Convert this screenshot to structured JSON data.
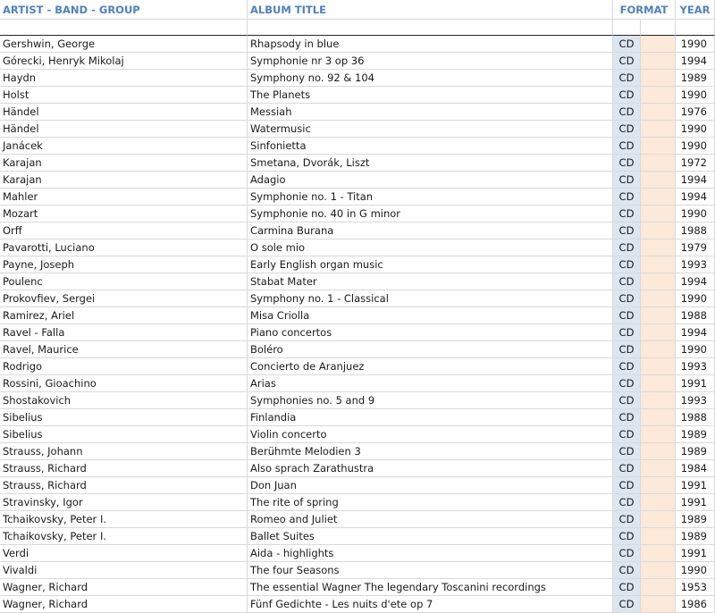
{
  "headers": {
    "artist": "ARTIST - BAND - GROUP",
    "album": "ALBUM TITLE",
    "format": "FORMAT",
    "year": "YEAR"
  },
  "colors": {
    "header_text": "#4f81bd",
    "format_column_fill": "#dce6f1",
    "blank_column_fill": "#fde9d9",
    "gridline": "#d9d9d9"
  },
  "rows": [
    {
      "artist": "Gershwin, George",
      "album": "Rhapsody in blue",
      "format": "CD",
      "year": "1990"
    },
    {
      "artist": "Górecki, Henryk Mikolaj",
      "album": "Symphonie nr 3 op 36",
      "format": "CD",
      "year": "1994"
    },
    {
      "artist": "Haydn",
      "album": "Symphony no. 92 & 104",
      "format": "CD",
      "year": "1989"
    },
    {
      "artist": "Holst",
      "album": "The Planets",
      "format": "CD",
      "year": "1990"
    },
    {
      "artist": "Händel",
      "album": "Messiah",
      "format": "CD",
      "year": "1976"
    },
    {
      "artist": "Händel",
      "album": "Watermusic",
      "format": "CD",
      "year": "1990"
    },
    {
      "artist": "Janácek",
      "album": "Sinfonietta",
      "format": "CD",
      "year": "1990"
    },
    {
      "artist": "Karajan",
      "album": "Smetana, Dvorák, Liszt",
      "format": "CD",
      "year": "1972"
    },
    {
      "artist": "Karajan",
      "album": "Adagio",
      "format": "CD",
      "year": "1994"
    },
    {
      "artist": "Mahler",
      "album": "Symphonie no. 1 - Titan",
      "format": "CD",
      "year": "1994"
    },
    {
      "artist": "Mozart",
      "album": "Symphonie no. 40 in G minor",
      "format": "CD",
      "year": "1990"
    },
    {
      "artist": "Orff",
      "album": "Carmina Burana",
      "format": "CD",
      "year": "1988"
    },
    {
      "artist": "Pavarotti, Luciano",
      "album": "O sole mio",
      "format": "CD",
      "year": "1979"
    },
    {
      "artist": "Payne, Joseph",
      "album": "Early English organ music",
      "format": "CD",
      "year": "1993"
    },
    {
      "artist": "Poulenc",
      "album": "Stabat Mater",
      "format": "CD",
      "year": "1994"
    },
    {
      "artist": "Prokovfiev, Sergei",
      "album": "Symphony no. 1 - Classical",
      "format": "CD",
      "year": "1990"
    },
    {
      "artist": "Ramirez, Ariel",
      "album": "Misa Criolla",
      "format": "CD",
      "year": "1988"
    },
    {
      "artist": "Ravel - Falla",
      "album": "Piano concertos",
      "format": "CD",
      "year": "1994"
    },
    {
      "artist": "Ravel, Maurice",
      "album": "Boléro",
      "format": "CD",
      "year": "1990"
    },
    {
      "artist": "Rodrigo",
      "album": "Concierto de Aranjuez",
      "format": "CD",
      "year": "1993"
    },
    {
      "artist": "Rossini, Gioachino",
      "album": "Arias",
      "format": "CD",
      "year": "1991"
    },
    {
      "artist": "Shostakovich",
      "album": "Symphonies no. 5 and 9",
      "format": "CD",
      "year": "1993"
    },
    {
      "artist": "Sibelius",
      "album": "Finlandia",
      "format": "CD",
      "year": "1988"
    },
    {
      "artist": "Sibelius",
      "album": "Violin concerto",
      "format": "CD",
      "year": "1989"
    },
    {
      "artist": "Strauss, Johann",
      "album": "Berühmte Melodien 3",
      "format": "CD",
      "year": "1989"
    },
    {
      "artist": "Strauss, Richard",
      "album": "Also  sprach Zarathustra",
      "format": "CD",
      "year": "1984"
    },
    {
      "artist": "Strauss, Richard",
      "album": "Don Juan",
      "format": "CD",
      "year": "1991"
    },
    {
      "artist": "Stravinsky, Igor",
      "album": "The rite of spring",
      "format": "CD",
      "year": "1991"
    },
    {
      "artist": "Tchaikovsky, Peter I.",
      "album": "Romeo and Juliet",
      "format": "CD",
      "year": "1989"
    },
    {
      "artist": "Tchaikovsky, Peter I.",
      "album": "Ballet Suites",
      "format": "CD",
      "year": "1989"
    },
    {
      "artist": "Verdi",
      "album": "Aida - highlights",
      "format": "CD",
      "year": "1991"
    },
    {
      "artist": "Vivaldi",
      "album": "The four Seasons",
      "format": "CD",
      "year": "1990"
    },
    {
      "artist": "Wagner, Richard",
      "album": "The essential Wagner  The legendary Toscanini recordings",
      "format": "CD",
      "year": "1953"
    },
    {
      "artist": "Wagner, Richard",
      "album": "Fünf Gedichte - Les nuits d'ete op 7",
      "format": "CD",
      "year": "1986"
    }
  ]
}
